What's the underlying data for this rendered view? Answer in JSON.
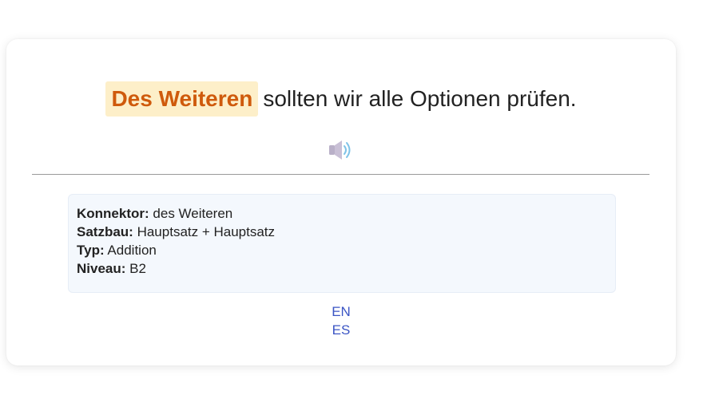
{
  "sentence": {
    "connector": "Des Weiteren",
    "rest": "sollten wir alle Optionen prüfen."
  },
  "audio": {
    "icon": "speaker-icon"
  },
  "info": {
    "connector_label": "Konnektor:",
    "connector_value": "des Weiteren",
    "structure_label": "Satzbau:",
    "structure_value": "Hauptsatz + Hauptsatz",
    "type_label": "Typ:",
    "type_value": "Addition",
    "level_label": "Niveau:",
    "level_value": "B2"
  },
  "languages": [
    "EN",
    "ES"
  ],
  "colors": {
    "highlight_bg": "#fdefc9",
    "highlight_text": "#cf5a0c",
    "link": "#3b55c4",
    "info_bg": "#f4f8fd"
  }
}
